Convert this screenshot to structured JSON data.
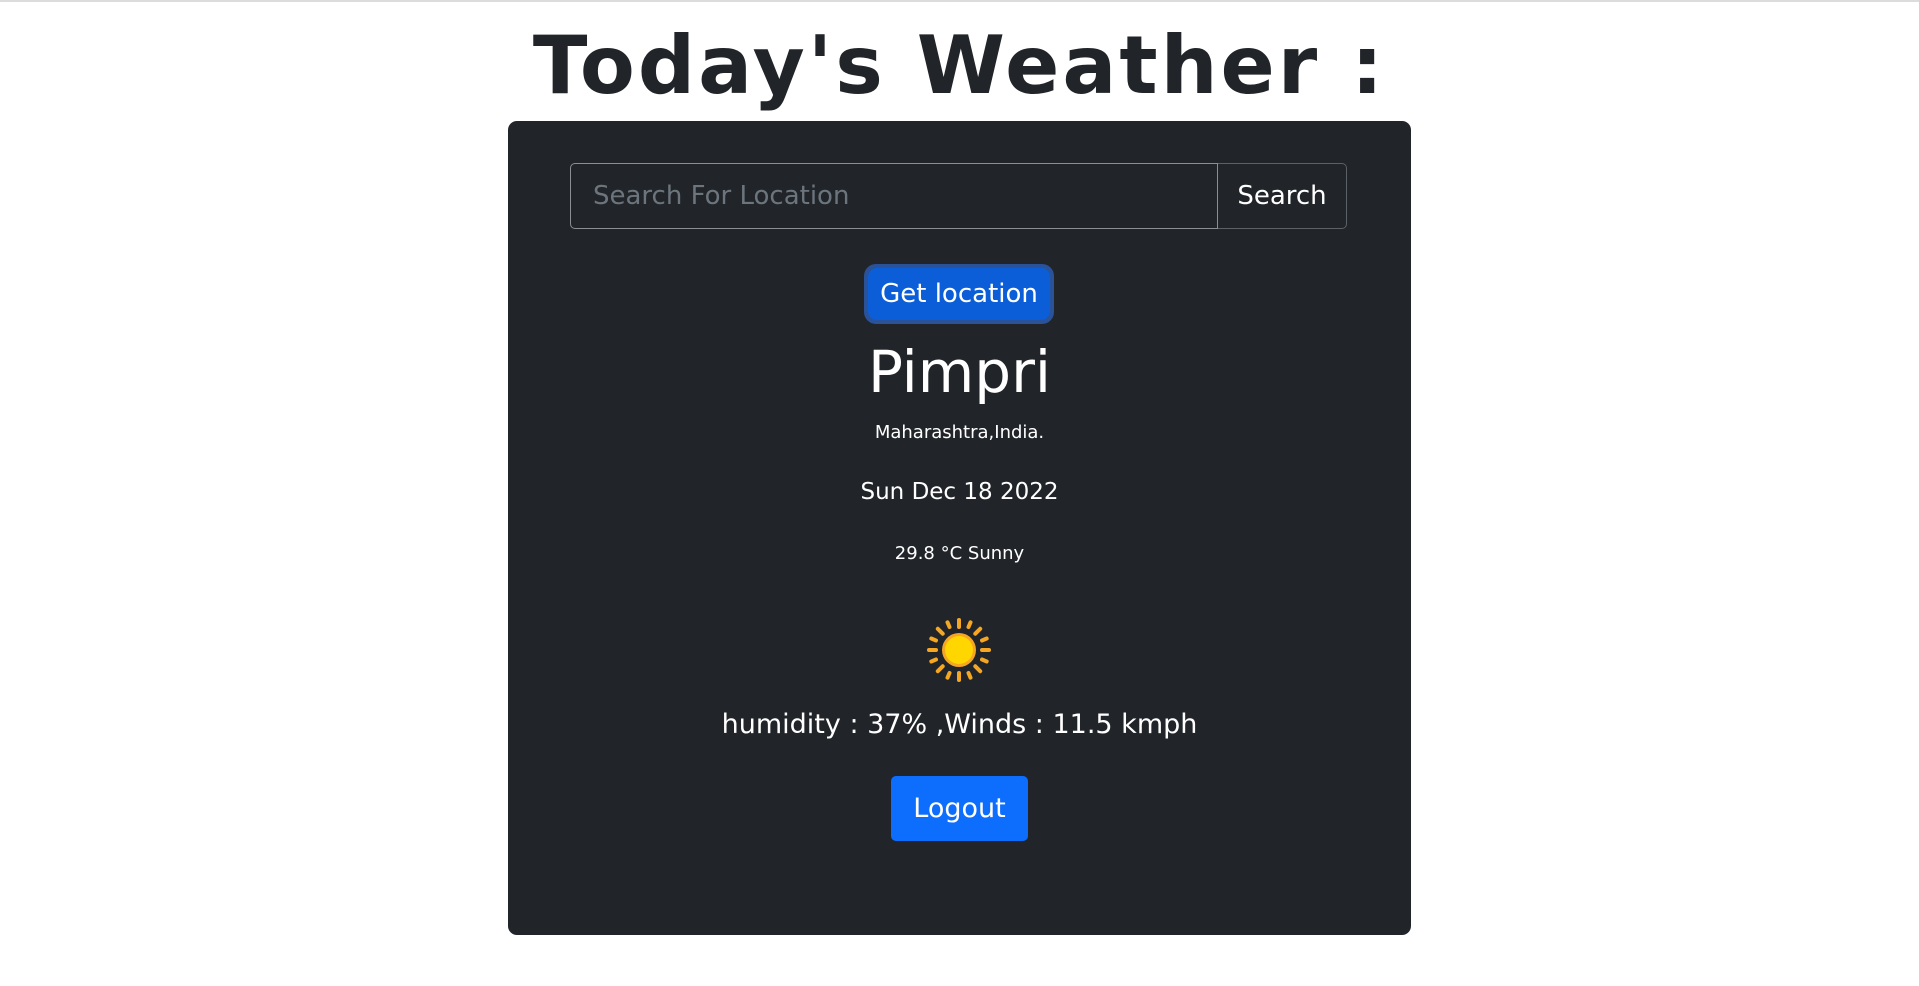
{
  "page": {
    "title": "Today's Weather :"
  },
  "search": {
    "placeholder": "Search For Location",
    "value": "",
    "button_label": "Search"
  },
  "location_button": {
    "label": "Get location"
  },
  "weather": {
    "city": "Pimpri",
    "region": "Maharashtra,India.",
    "date": "Sun Dec 18 2022",
    "temperature_condition": "29.8 °C Sunny",
    "condition_icon": "sun-icon",
    "details": "humidity : 37% ,Winds : 11.5 kmph"
  },
  "logout": {
    "label": "Logout"
  },
  "colors": {
    "card_bg": "#212529",
    "primary": "#0d6efd",
    "sun": "#FFD600",
    "sun_rays": "#F5A623",
    "title_text": "#212529"
  }
}
